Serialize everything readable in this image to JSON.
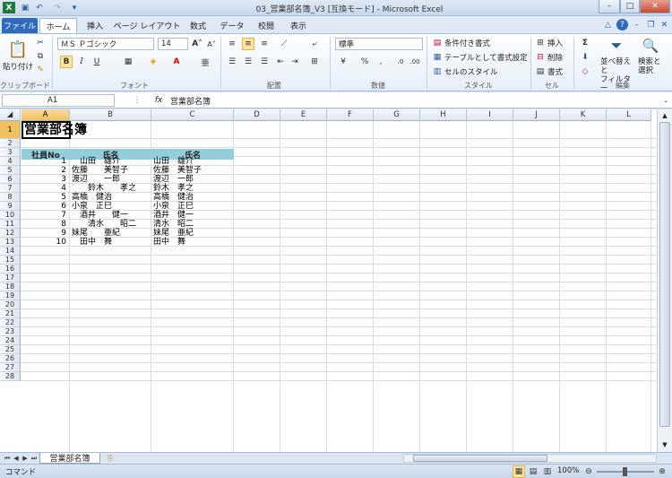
{
  "window": {
    "title": "03_営業部名簿_V3 [互換モード] - Microsoft Excel",
    "minimize": "–",
    "restore": "□",
    "close": "✕"
  },
  "tabs": [
    "ファイル",
    "ホーム",
    "挿入",
    "ページ レイアウト",
    "数式",
    "データ",
    "校閲",
    "表示"
  ],
  "ribbon": {
    "clipboard": {
      "paste": "貼り付け",
      "label": "クリップボード"
    },
    "font": {
      "name": "ＭＳ Ｐゴシック",
      "size": "14",
      "label": "フォント",
      "bold": "B",
      "italic": "I",
      "underline": "U"
    },
    "alignment": {
      "label": "配置"
    },
    "number": {
      "format": "標準",
      "label": "数値",
      "percent": "%",
      "comma": ","
    },
    "styles": {
      "conditional": "条件付き書式",
      "table": "テーブルとして書式設定",
      "cell": "セルのスタイル",
      "label": "スタイル"
    },
    "cells": {
      "insert": "挿入",
      "delete": "削除",
      "format": "書式",
      "label": "セル"
    },
    "editing": {
      "sort": "並べ替えと\nフィルター",
      "find": "検索と\n選択",
      "label": "編集"
    }
  },
  "formula_bar": {
    "name_box": "A1",
    "fx": "fx",
    "value": "営業部名簿"
  },
  "columns": [
    "A",
    "B",
    "C",
    "D",
    "E",
    "F",
    "G",
    "H",
    "I",
    "J",
    "K",
    "L"
  ],
  "rows": [
    "1",
    "2",
    "3",
    "4",
    "5",
    "6",
    "7",
    "8",
    "9",
    "10",
    "11",
    "12",
    "13",
    "14",
    "15",
    "16",
    "17",
    "18",
    "19",
    "20",
    "21",
    "22",
    "23",
    "24",
    "25",
    "26",
    "27",
    "28"
  ],
  "sheet": {
    "title": "営業部名簿",
    "headers": [
      "社員No",
      "氏名",
      "氏名"
    ],
    "data": [
      {
        "no": "1",
        "b": "　山田　雄介",
        "c": "山田　雄介"
      },
      {
        "no": "2",
        "b": "佐藤　　美智子",
        "c": "佐藤　美智子"
      },
      {
        "no": "3",
        "b": "渡辺　　一郎",
        "c": "渡辺　一郎"
      },
      {
        "no": "4",
        "b": "　　鈴木　　孝之",
        "c": "鈴木　孝之"
      },
      {
        "no": "5",
        "b": "高橋　健治",
        "c": "高橋　健治"
      },
      {
        "no": "6",
        "b": "小泉　正巳",
        "c": "小泉　正巳"
      },
      {
        "no": "7",
        "b": "　酒井　　健一",
        "c": "酒井　健一"
      },
      {
        "no": "8",
        "b": "　　清水　　昭二",
        "c": "清水　昭二"
      },
      {
        "no": "9",
        "b": "妹尾　　亜紀",
        "c": "妹尾　亜紀"
      },
      {
        "no": "10",
        "b": "　田中　舞",
        "c": "田中　舞"
      }
    ]
  },
  "sheet_tab": "営業部名簿",
  "status": {
    "mode": "コマンド",
    "zoom": "100%"
  },
  "colors": {
    "header_fill": "#92cddc",
    "file_tab": "#2f6bbd"
  }
}
